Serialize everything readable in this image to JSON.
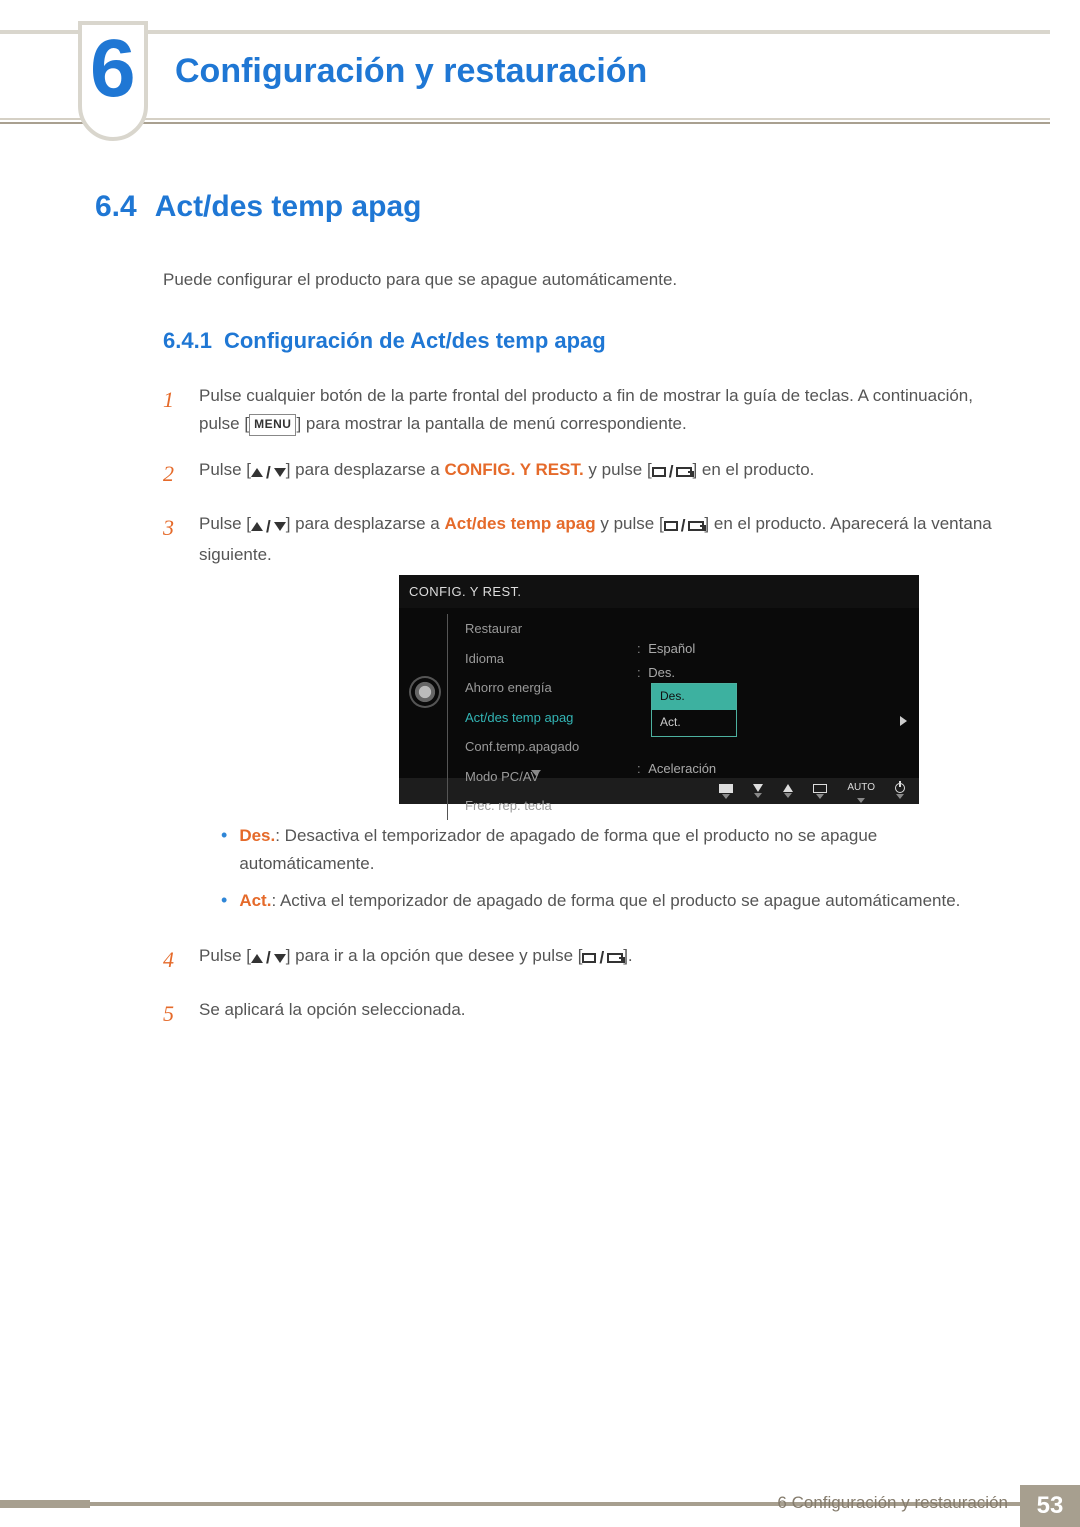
{
  "chapter": {
    "number": "6",
    "title": "Configuración y restauración"
  },
  "section": {
    "number": "6.4",
    "title": "Act/des temp apag",
    "intro": "Puede configurar el producto para que se apague automáticamente."
  },
  "subsection": {
    "number": "6.4.1",
    "title": "Configuración de Act/des temp apag"
  },
  "menu_key_label": "MENU",
  "steps": {
    "s1a": "Pulse cualquier botón de la parte frontal del producto a fin de mostrar la guía de teclas. A continuación, pulse [",
    "s1b": "] para mostrar la pantalla de menú correspondiente.",
    "s2a": "Pulse [",
    "s2b": "] para desplazarse a ",
    "s2c": "CONFIG. Y REST.",
    "s2d": " y pulse [",
    "s2e": "] en el producto.",
    "s3a": "Pulse [",
    "s3b": "] para desplazarse a ",
    "s3c": "Act/des temp apag",
    "s3d": " y pulse [",
    "s3e": "] en el producto. Aparecerá la ventana siguiente.",
    "s4a": "Pulse [",
    "s4b": "] para ir a la opción que desee y pulse [",
    "s4c": "].",
    "s5": "Se aplicará la opción seleccionada."
  },
  "bullets": {
    "des_term": "Des.",
    "des_text": ": Desactiva el temporizador de apagado de forma que el producto no se apague automáticamente.",
    "act_term": "Act.",
    "act_text": ": Activa el temporizador de apagado de forma que el producto se apague automáticamente."
  },
  "osd": {
    "title": "CONFIG. Y REST.",
    "items": {
      "restaurar": "Restaurar",
      "idioma": "Idioma",
      "ahorro": "Ahorro energía",
      "actdes": "Act/des temp apag",
      "conf": "Conf.temp.apagado",
      "modo": "Modo PC/AV",
      "frec": "Frec. rep. tecla"
    },
    "values": {
      "idioma": "Español",
      "ahorro": "Des.",
      "frec": "Aceleración"
    },
    "dropdown": {
      "des": "Des.",
      "act": "Act."
    },
    "footer_auto": "AUTO"
  },
  "footer": {
    "label": "6 Configuración y restauración",
    "page": "53"
  }
}
